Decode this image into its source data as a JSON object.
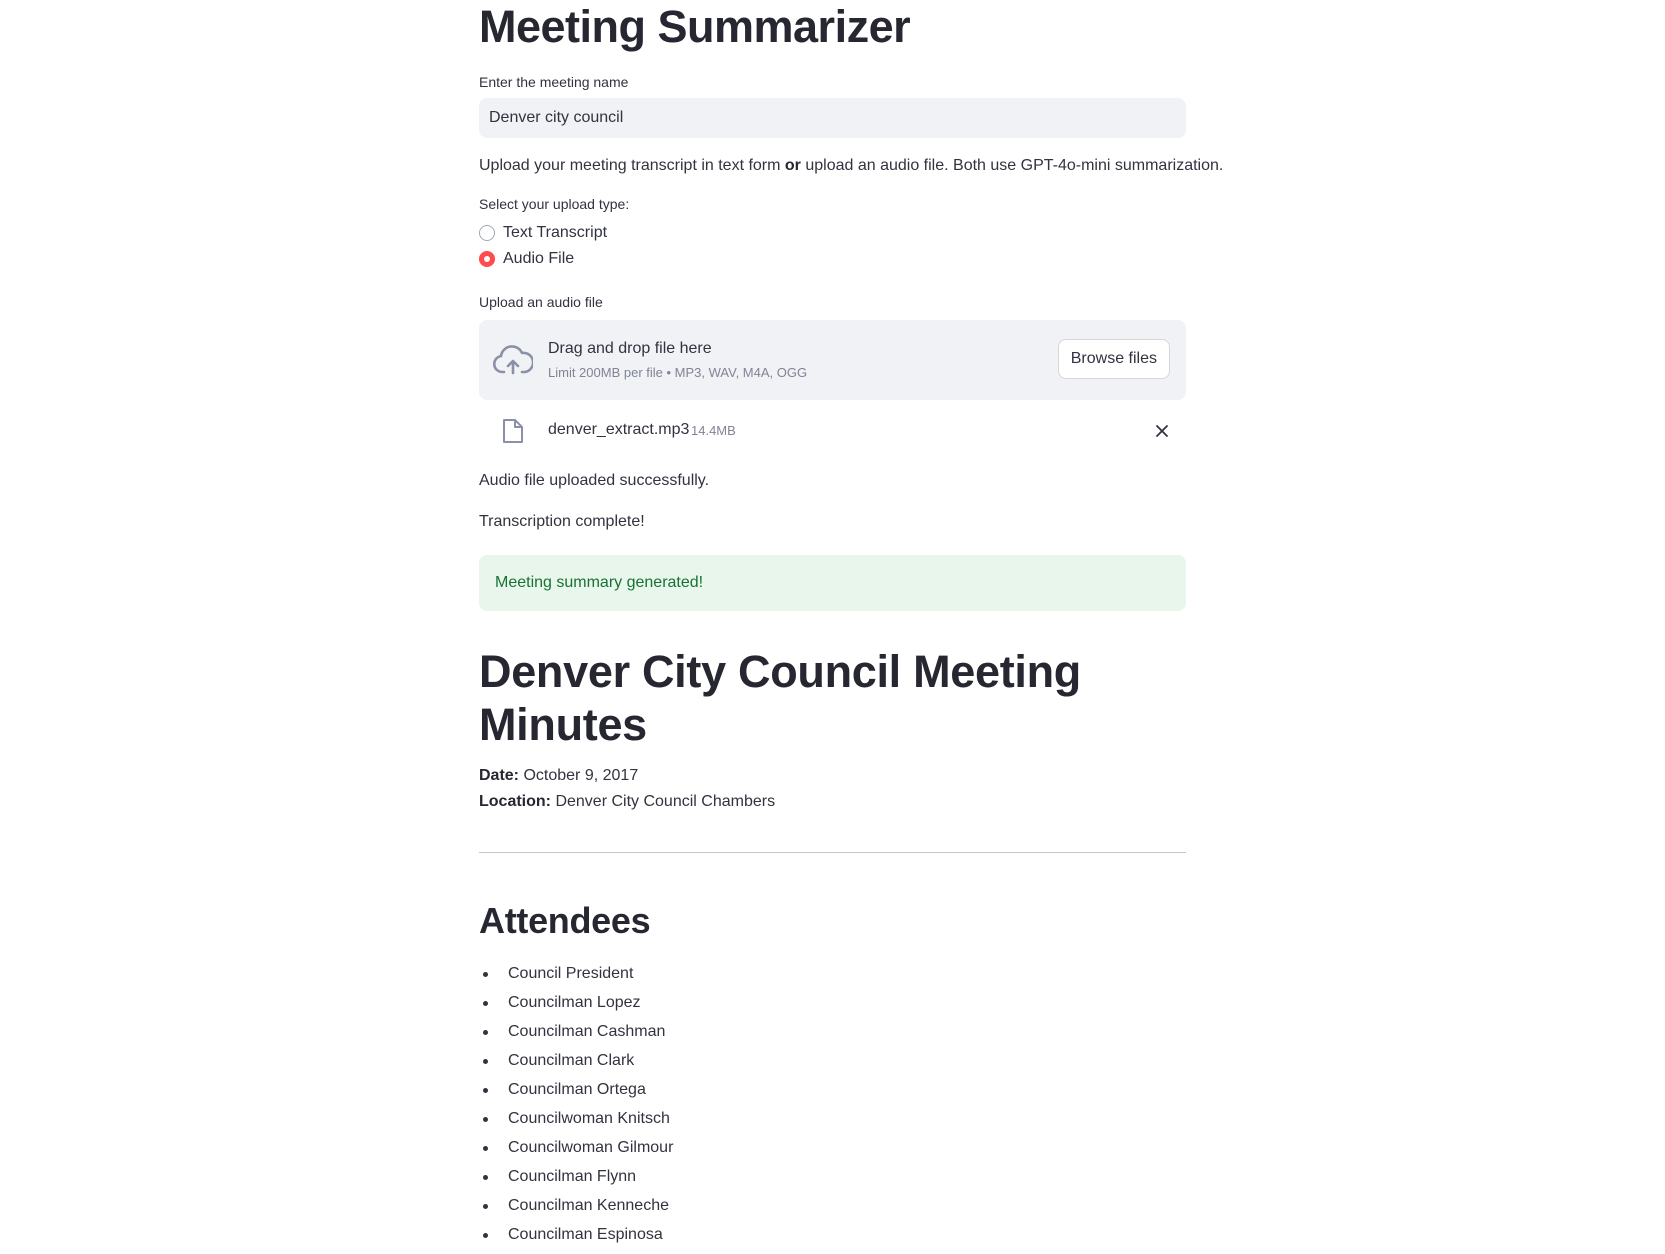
{
  "app": {
    "title": "Meeting Summarizer"
  },
  "meeting_name": {
    "label": "Enter the meeting name",
    "value": "Denver city council"
  },
  "description": {
    "part1": "Upload your meeting transcript in text form ",
    "bold": "or",
    "part2": " upload an audio file. Both use GPT-4o-mini summarization."
  },
  "upload_type": {
    "label": "Select your upload type:",
    "options": [
      {
        "label": "Text Transcript",
        "selected": false
      },
      {
        "label": "Audio File",
        "selected": true
      }
    ]
  },
  "uploader": {
    "label": "Upload an audio file",
    "drop_title": "Drag and drop file here",
    "drop_hint": "Limit 200MB per file • MP3, WAV, M4A, OGG",
    "browse_label": "Browse files",
    "file": {
      "name": "denver_extract.mp3",
      "size": "14.4MB"
    }
  },
  "status": {
    "uploaded": "Audio file uploaded successfully.",
    "transcribed": "Transcription complete!",
    "success": "Meeting summary generated!"
  },
  "minutes": {
    "title": "Denver City Council Meeting Minutes",
    "date_label": "Date:",
    "date_value": "October 9, 2017",
    "location_label": "Location:",
    "location_value": "Denver City Council Chambers",
    "attendees_heading": "Attendees",
    "attendees": [
      "Council President",
      "Councilman Lopez",
      "Councilman Cashman",
      "Councilman Clark",
      "Councilman Ortega",
      "Councilwoman Knitsch",
      "Councilwoman Gilmour",
      "Councilman Flynn",
      "Councilman Kenneche",
      "Councilman Espinosa"
    ]
  },
  "colors": {
    "accent": "#ff4b4b",
    "success_bg": "#e8f6ec",
    "success_text": "#177233",
    "input_bg": "#f0f2f6"
  },
  "icons": {
    "upload": "cloud-upload-icon",
    "file": "file-icon",
    "close": "close-icon"
  }
}
